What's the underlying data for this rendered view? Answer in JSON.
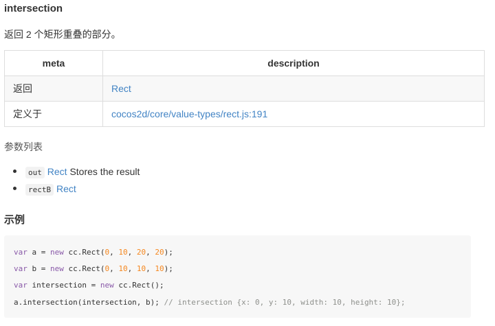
{
  "section": {
    "title": "intersection",
    "description": "返回 2 个矩形重叠的部分。"
  },
  "meta_table": {
    "headers": [
      "meta",
      "description"
    ],
    "rows": [
      {
        "key": "返回",
        "value": "Rect"
      },
      {
        "key": "定义于",
        "value": "cocos2d/core/value-types/rect.js:191"
      }
    ]
  },
  "params": {
    "title": "参数列表",
    "items": [
      {
        "name": "out",
        "type": "Rect",
        "desc": " Stores the result"
      },
      {
        "name": "rectB",
        "type": "Rect",
        "desc": ""
      }
    ]
  },
  "example": {
    "title": "示例",
    "lines": [
      [
        [
          "kw",
          "var"
        ],
        [
          "t",
          " a = "
        ],
        [
          "kw",
          "new"
        ],
        [
          "t",
          " cc.Rect("
        ],
        [
          "num",
          "0"
        ],
        [
          "t",
          ", "
        ],
        [
          "num",
          "10"
        ],
        [
          "t",
          ", "
        ],
        [
          "num",
          "20"
        ],
        [
          "t",
          ", "
        ],
        [
          "num",
          "20"
        ],
        [
          "t",
          ");"
        ]
      ],
      [
        [
          "kw",
          "var"
        ],
        [
          "t",
          " b = "
        ],
        [
          "kw",
          "new"
        ],
        [
          "t",
          " cc.Rect("
        ],
        [
          "num",
          "0"
        ],
        [
          "t",
          ", "
        ],
        [
          "num",
          "10"
        ],
        [
          "t",
          ", "
        ],
        [
          "num",
          "10"
        ],
        [
          "t",
          ", "
        ],
        [
          "num",
          "10"
        ],
        [
          "t",
          ");"
        ]
      ],
      [
        [
          "kw",
          "var"
        ],
        [
          "t",
          " intersection = "
        ],
        [
          "kw",
          "new"
        ],
        [
          "t",
          " cc.Rect();"
        ]
      ],
      [
        [
          "t",
          "a.intersection(intersection, b); "
        ],
        [
          "cm",
          "// intersection {x: 0, y: 10, width: 10, height: 10};"
        ]
      ]
    ]
  },
  "colors": {
    "link": "#4183c4",
    "keyword": "#8959a8",
    "number": "#f5871f",
    "comment": "#8e908c"
  }
}
